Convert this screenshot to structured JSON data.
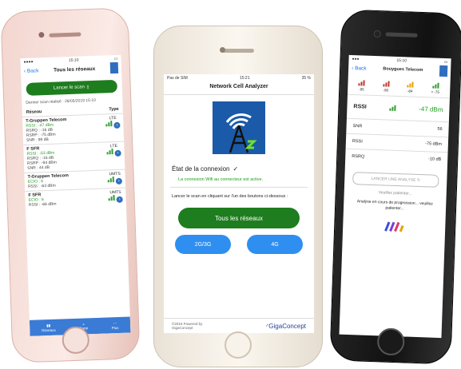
{
  "phone1": {
    "status_time": "15:10",
    "back_label": "Back",
    "title": "Tous les réseaux",
    "scan_button": "Lancer le scan",
    "last_scan": "Dernier scan réalisé : 28/05/2019 15:10",
    "col_network": "Réseau",
    "col_type": "Type",
    "networks": [
      {
        "name": "T-Gruppen Telecom",
        "line1": "RSSI : -47 dBm",
        "line2": "RSRQ : -16 dB",
        "line3": "RSRP : -75 dBm",
        "line4": "SNR : 99 dB",
        "type": "LTE"
      },
      {
        "name": "F SFR",
        "line1": "RSSI : -53 dBm",
        "line2": "RSRQ : -16 dB",
        "line3": "RSRP : -94 dBm",
        "line4": "SNR : 44 dB",
        "type": "LTE"
      },
      {
        "name": "T-Gruppen Telecom",
        "line1": "ECIO : 6",
        "line2": "RSSI : -63 dBm",
        "line3": "",
        "line4": "",
        "type": "UMTS"
      },
      {
        "name": "F SFR",
        "line1": "ECIO : 6",
        "line2": "RSSI : -66 dBm",
        "line3": "",
        "line4": "",
        "type": "UMTS"
      }
    ],
    "tabs": [
      "Réseaux",
      "Carte",
      "Plus"
    ]
  },
  "phone2": {
    "status_carrier": "Pas de SIM",
    "status_time": "15:21",
    "status_battery": "35 %",
    "title": "Network Cell Analyzer",
    "connection_title": "État de la connexion",
    "connection_status": "La connexion Wifi au connecteur est active.",
    "instruction": "Lancer le scan en cliquant sur l'un des boutons ci-dessous :",
    "btn_all": "Tous les réseaux",
    "btn_2g3g": "2G/3G",
    "btn_4g": "4G",
    "footer_left": "©2019 Powered by GigaConcept",
    "footer_brand": "GigaConcept"
  },
  "phone3": {
    "status_time": "15:10",
    "back_label": "Back",
    "title": "Bouygues Telecom",
    "bars": [
      {
        "color": "#c0392b",
        "value": "-95"
      },
      {
        "color": "#c0392b",
        "value": "-90"
      },
      {
        "color": "#e6a100",
        "value": "-84"
      },
      {
        "color": "#2e9e2e",
        "value": "> -75"
      }
    ],
    "rssi_label": "RSSI",
    "rssi_value": "-47 dBm",
    "rows": [
      {
        "label": "SNR",
        "value": "56"
      },
      {
        "label": "RSSI",
        "value": "-75 dBm"
      },
      {
        "label": "RSRQ",
        "value": "-10 dB"
      }
    ],
    "analysis_button": "LANCER UNE ANALYSE",
    "wait_text": "Veuillez patienter...",
    "analysis_note": "Analyse en cours de progression... veuillez patienter..."
  },
  "colors": {
    "green": "#1e7d1e",
    "blue": "#2f8ff0",
    "tabbar": "#3a7bd5"
  }
}
